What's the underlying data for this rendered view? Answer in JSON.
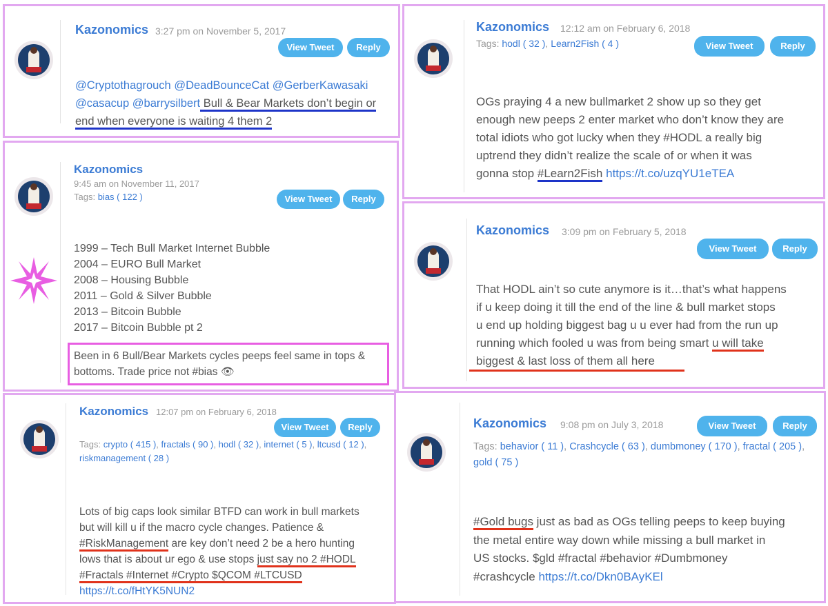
{
  "author": "Kazonomics",
  "buttons": {
    "view_tweet": "View Tweet",
    "reply": "Reply"
  },
  "tags_label": "Tags:",
  "tweets": [
    {
      "time": "3:27 pm",
      "on_date": "on November 5, 2017",
      "lines": [
        [
          "@Cryptothagrouch @DeadBounceCat @GerberKawasaki"
        ],
        [
          "@casacup @barrysilbert",
          " Bull & Bear Markets don’t begin or"
        ],
        [
          "end when everyone is waiting 4 them 2"
        ]
      ]
    },
    {
      "meta": "9:45 am on November 11, 2017",
      "tags": [
        "bias ( 122 )"
      ],
      "list": [
        "1999 – Tech Bull Market Internet Bubble",
        "2004 – EURO Bull Market",
        "2008 – Housing Bubble",
        "2011 – Gold & Silver Bubble",
        "2013 – Bitcoin Bubble",
        "2017 – Bitcoin Bubble pt 2"
      ],
      "boxed": [
        "Been in 6 Bull/Bear Markets cycles peeps feel same in tops &",
        "bottoms. Trade price not #bias"
      ],
      "emoji": "👁"
    },
    {
      "time": "12:07 pm",
      "on_date": "on February 6, 2018",
      "tags_row1": [
        "crypto ( 415 )",
        "fractals ( 90 )",
        "hodl ( 32 )",
        "internet ( 5 )",
        "ltcusd ( 12 )"
      ],
      "tags_row2": [
        "riskmanagement ( 28 )"
      ],
      "lines": [
        [
          "Lots of big caps look similar BTFD can work in bull markets"
        ],
        [
          "but will kill u if the macro cycle changes. Patience &"
        ],
        [
          "#RiskManagement",
          " are key don’t need 2 be a hero hunting"
        ],
        [
          "lows that is about ur ego & use stops ",
          "just say no 2 #HODL"
        ],
        [
          "#Fractals #Internet #Crypto $QCOM #LTCUSD"
        ],
        [
          "https://t.co/fHtYK5NUN2"
        ]
      ]
    },
    {
      "time": "12:12 am",
      "on_date": "on February 6, 2018",
      "tags": [
        "hodl ( 32 )",
        "Learn2Fish ( 4 )"
      ],
      "lines": [
        [
          "OGs praying 4 a new bullmarket 2 show up so they get"
        ],
        [
          "enough new peeps 2 enter market who don’t know they are"
        ],
        [
          "total idiots who got lucky when they #HODL a really big"
        ],
        [
          "uptrend they didn’t realize the scale of or when it was"
        ],
        [
          "gonna stop ",
          "#Learn2Fish",
          " ",
          "https://t.co/uzqYU1eTEA"
        ]
      ]
    },
    {
      "time": "3:09 pm",
      "on_date": "on February 5, 2018",
      "lines": [
        [
          "That HODL ain’t so cute anymore is it…that’s what happens"
        ],
        [
          "if u keep doing it till the end of the line & bull market stops"
        ],
        [
          "u end up holding biggest bag u u ever had from the run up"
        ],
        [
          "running which fooled u was from being smart ",
          "u will take"
        ],
        [
          "biggest & last loss of them all here"
        ]
      ]
    },
    {
      "time": "9:08 pm",
      "on_date": "on July 3, 2018",
      "tags_row1": [
        "behavior ( 11 )",
        "Crashcycle ( 63 )",
        "dumbmoney ( 170 )",
        "fractal ( 205 )"
      ],
      "tags_row2": [
        "gold ( 75 )"
      ],
      "lines": [
        [
          "#Gold bugs",
          " just as bad as OGs telling peeps to keep buying"
        ],
        [
          "the metal entire way down while missing a bull market in"
        ],
        [
          "US stocks. $gld #fractal #behavior #Dumbmoney"
        ],
        [
          "#crashcycle ",
          "https://t.co/Dkn0BAyKEl"
        ]
      ]
    }
  ]
}
